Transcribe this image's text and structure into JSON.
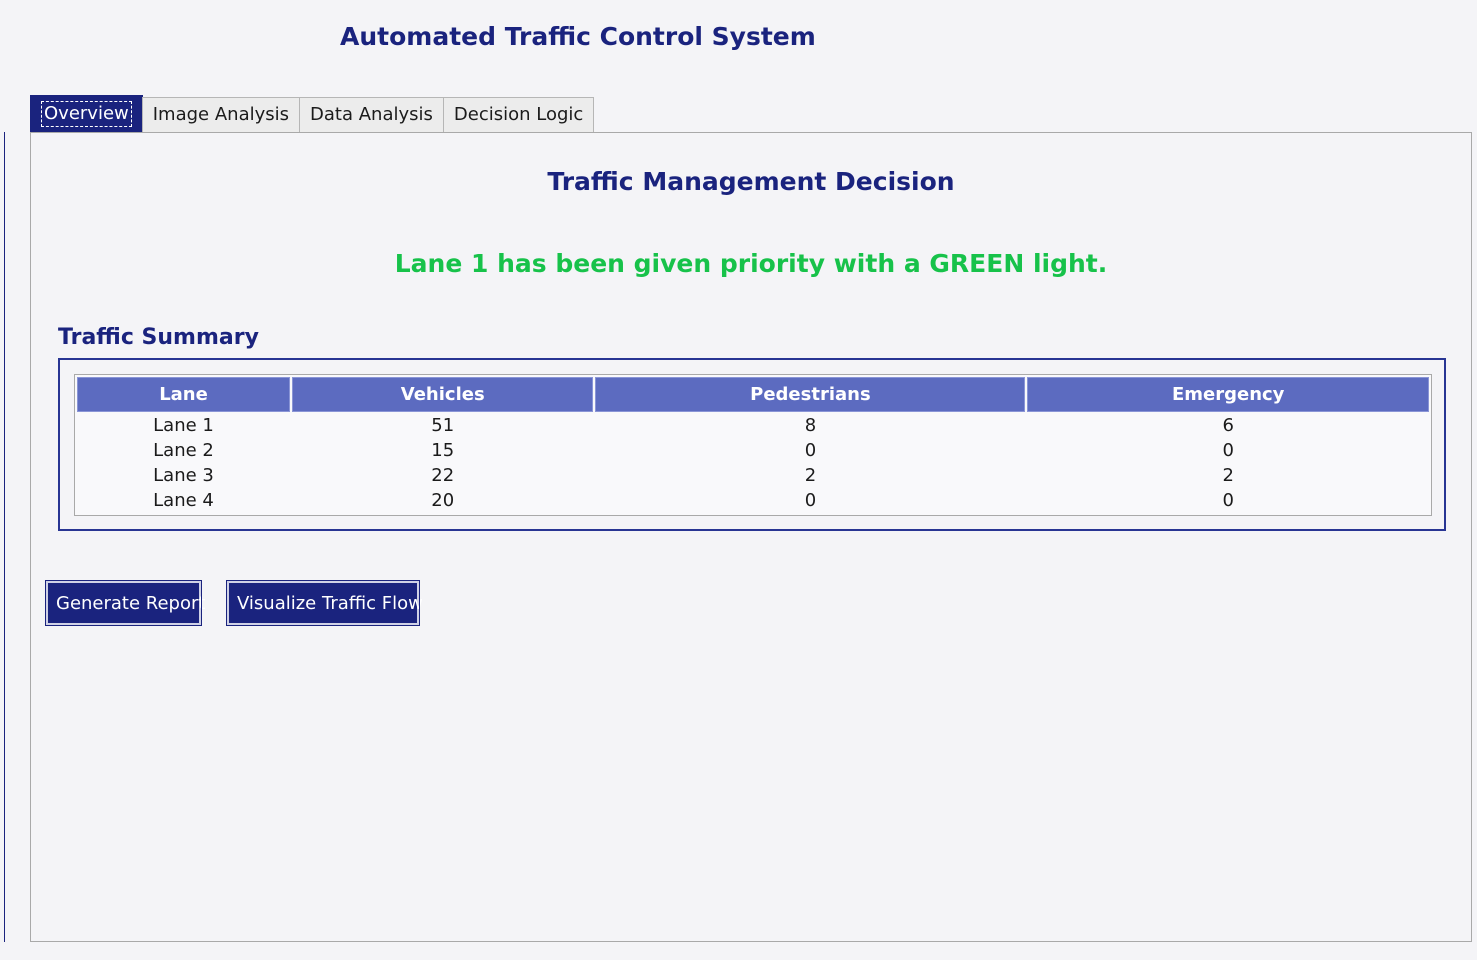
{
  "app": {
    "title": "Automated Traffic Control System"
  },
  "tabs": [
    {
      "label": "Overview",
      "active": true
    },
    {
      "label": "Image Analysis",
      "active": false
    },
    {
      "label": "Data Analysis",
      "active": false
    },
    {
      "label": "Decision Logic",
      "active": false
    }
  ],
  "overview": {
    "decision_heading": "Traffic Management Decision",
    "decision_message": "Lane 1 has been given priority with a GREEN light.",
    "summary_heading": "Traffic Summary",
    "table": {
      "columns": [
        "Lane",
        "Vehicles",
        "Pedestrians",
        "Emergency"
      ],
      "rows": [
        [
          "Lane 1",
          "51",
          "8",
          "6"
        ],
        [
          "Lane 2",
          "15",
          "0",
          "0"
        ],
        [
          "Lane 3",
          "22",
          "2",
          "2"
        ],
        [
          "Lane 4",
          "20",
          "0",
          "0"
        ]
      ]
    },
    "buttons": {
      "generate_report": "Generate Report",
      "visualize_flow": "Visualize Traffic Flow"
    }
  },
  "colors": {
    "primary": "#1a237e",
    "header": "#5c6bc0",
    "success": "#17c24a",
    "background": "#f4f4f7"
  }
}
